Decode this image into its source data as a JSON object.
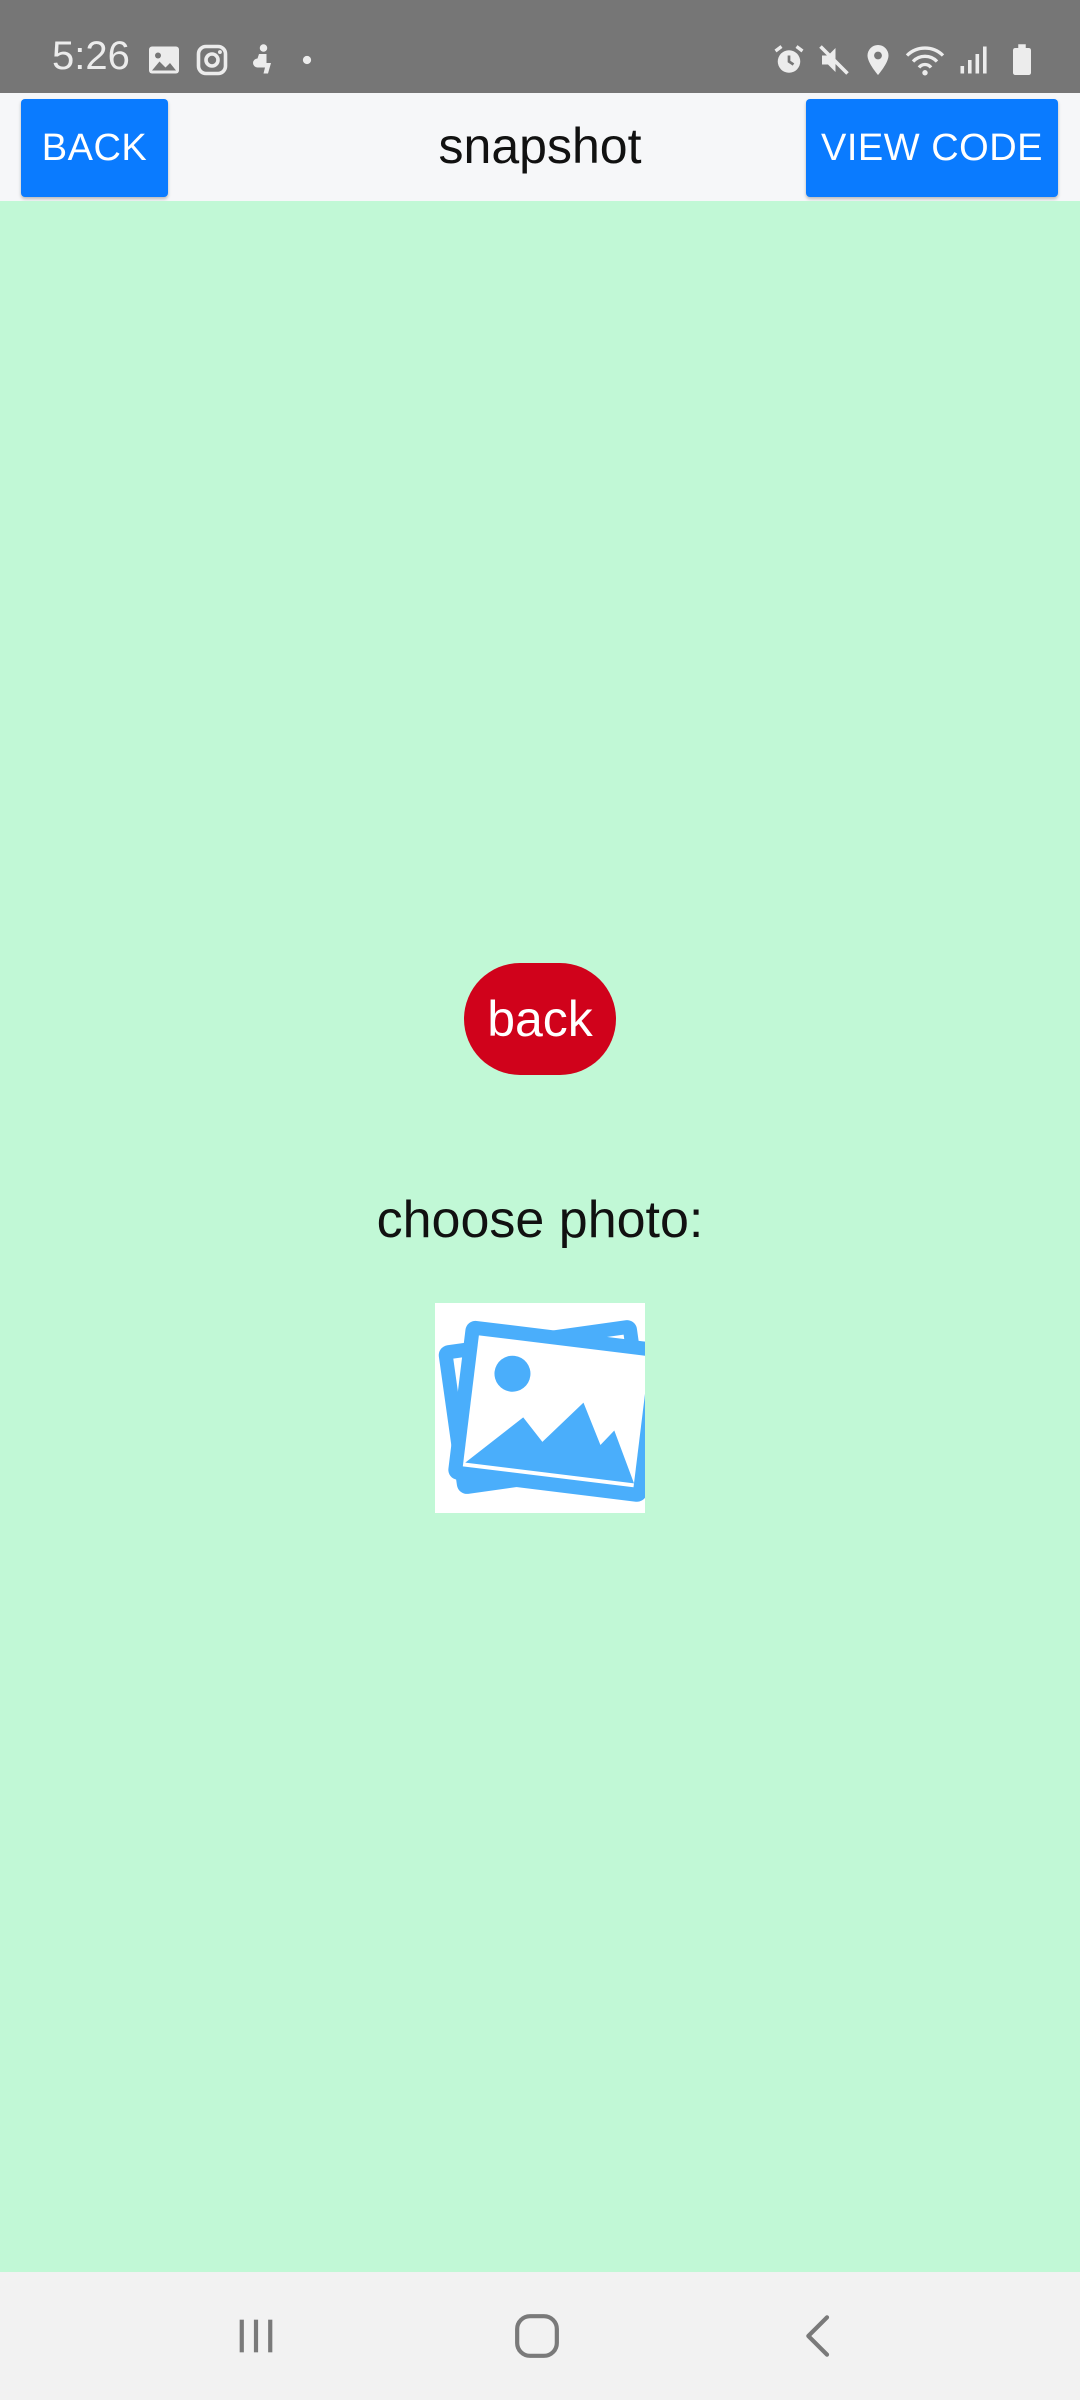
{
  "status_bar": {
    "time": "5:26",
    "left_icons": [
      "gallery-icon",
      "instagram-icon",
      "accessibility-icon",
      "dot-icon"
    ],
    "right_icons": [
      "alarm-icon",
      "mute-icon",
      "location-icon",
      "wifi-icon",
      "signal-icon",
      "battery-icon"
    ]
  },
  "header": {
    "back_label": "BACK",
    "title": "snapshot",
    "view_code_label": "VIEW CODE"
  },
  "main": {
    "back_button_label": "back",
    "choose_label": "choose photo:",
    "photo_icon": "image-gallery-icon"
  },
  "nav_bar": {
    "icons": [
      "recents-icon",
      "home-icon",
      "back-arrow-icon"
    ]
  },
  "colors": {
    "background": "#c1f8d6",
    "header_bg": "#f6f7f9",
    "button_blue": "#0a7bff",
    "back_red": "#d0021b",
    "photo_icon_blue": "#4aaefb",
    "status_bar": "#767676"
  }
}
